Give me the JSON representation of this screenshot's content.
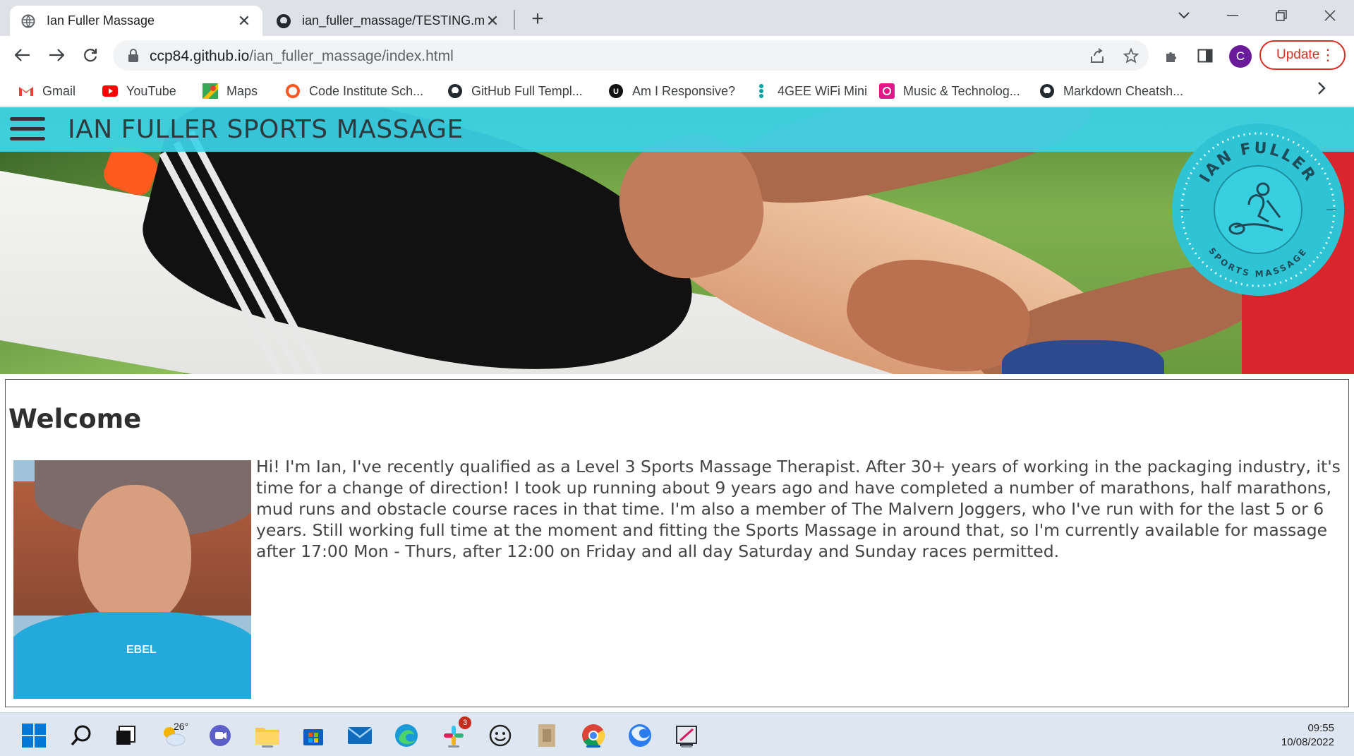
{
  "browser": {
    "tabs": [
      {
        "title": "Ian Fuller Massage",
        "icon": "globe-icon",
        "active": true
      },
      {
        "title": "ian_fuller_massage/TESTING.md",
        "icon": "github-icon",
        "active": false
      }
    ],
    "url_host": "ccp84.github.io",
    "url_path": "/ian_fuller_massage/index.html",
    "profile_initial": "C",
    "update_label": "Update",
    "bookmarks": [
      {
        "label": "Gmail",
        "icon": "gmail-icon"
      },
      {
        "label": "YouTube",
        "icon": "youtube-icon"
      },
      {
        "label": "Maps",
        "icon": "maps-icon"
      },
      {
        "label": "Code Institute Sch...",
        "icon": "code-institute-icon"
      },
      {
        "label": "GitHub Full Templ...",
        "icon": "github-icon"
      },
      {
        "label": "Am I Responsive?",
        "icon": "amiresponsive-icon"
      },
      {
        "label": "4GEE WiFi Mini",
        "icon": "ee-icon"
      },
      {
        "label": "Music & Technolog...",
        "icon": "music-icon"
      },
      {
        "label": "Markdown Cheatsh...",
        "icon": "github-icon"
      }
    ]
  },
  "site": {
    "title": "IAN FULLER SPORTS MASSAGE",
    "logo": {
      "top_text": "IAN FULLER",
      "bottom_text": "SPORTS MASSAGE"
    },
    "welcome_heading": "Welcome",
    "portrait_shirt_text": "EBEL",
    "intro_text": "Hi! I'm Ian, I've recently qualified as a Level 3 Sports Massage Therapist. After 30+ years of working in the packaging industry, it's time for a change of direction! I took up running about 9 years ago and have completed a number of marathons, half marathons, mud runs and obstacle course races in that time. I'm also a member of The Malvern Joggers, who I've run with for the last 5 or 6 years. Still working full time at the moment and fitting the Sports Massage in around that, so I'm currently available for massage after 17:00 Mon - Thurs, after 12:00 on Friday and all day Saturday and Sunday races permitted."
  },
  "taskbar": {
    "weather_temp": "26°",
    "slack_badge": "3",
    "time": "09:55",
    "date": "10/08/2022"
  },
  "colors": {
    "nav_bar": "#3cd4e8",
    "accent_teal": "#2ec4d6",
    "update_red": "#d93025"
  }
}
